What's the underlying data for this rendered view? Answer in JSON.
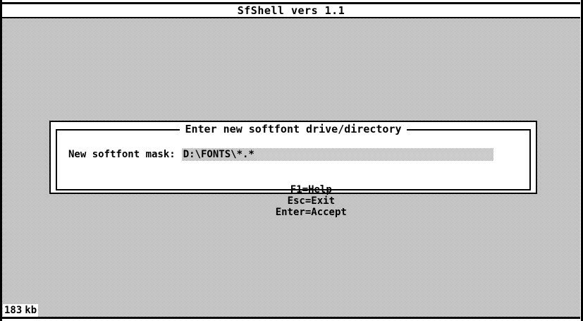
{
  "app": {
    "title": "SfShell vers 1.1"
  },
  "dialog": {
    "title": "Enter new softfont drive/directory",
    "mask_label": "New softfont mask:",
    "mask_value": "D:\\FONTS\\*.*",
    "hints": [
      "F1=Help",
      "Esc=Exit",
      "Enter=Accept"
    ]
  },
  "status": {
    "memory_value": "183",
    "memory_unit": "kb"
  }
}
